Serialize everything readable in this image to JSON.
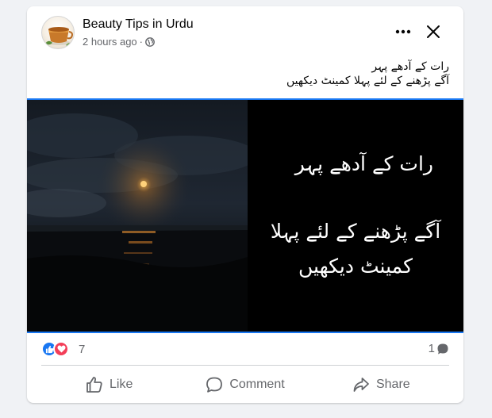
{
  "post": {
    "page_name": "Beauty Tips in Urdu",
    "timestamp": "2 hours ago",
    "separator": "·",
    "privacy_icon": "globe-icon",
    "caption_lines": [
      "رات کے آدھے پہر",
      "آگے  پڑھنے کے لئے پہلا کمینٹ دیکھیں"
    ],
    "image_text": {
      "line1": "رات کے آدھے پہر",
      "line2": "آگے  پڑھنے کے لئے پہلا کمینٹ دیکھیں"
    }
  },
  "stats": {
    "reactions": [
      "like",
      "love"
    ],
    "reaction_count": "7",
    "comment_count": "1"
  },
  "actions": {
    "like_label": "Like",
    "comment_label": "Comment",
    "share_label": "Share"
  },
  "colors": {
    "accent": "#1877f2",
    "like": "#1877f2",
    "love": "#f33e58",
    "secondary_text": "#65676b"
  }
}
